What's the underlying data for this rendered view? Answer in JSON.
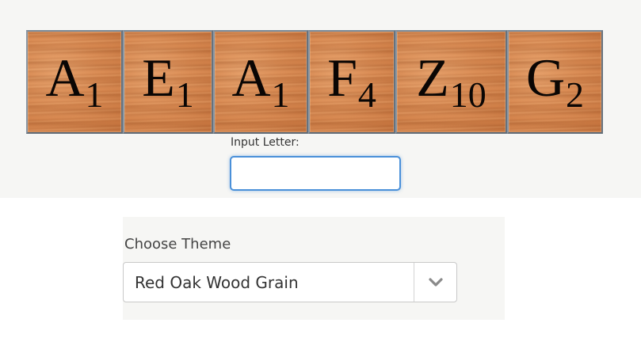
{
  "tiles": [
    {
      "letter": "A",
      "score": "1"
    },
    {
      "letter": "E",
      "score": "1"
    },
    {
      "letter": "A",
      "score": "1"
    },
    {
      "letter": "F",
      "score": "4"
    },
    {
      "letter": "Z",
      "score": "10"
    },
    {
      "letter": "G",
      "score": "2"
    }
  ],
  "input": {
    "label": "Input Letter:",
    "value": ""
  },
  "theme": {
    "label": "Choose Theme",
    "selected": "Red Oak Wood Grain",
    "chevron_icon": "chevron-down-icon"
  },
  "colors": {
    "input_focus": "#4a90d9",
    "tile_wood": "#d98a52",
    "panel_bg": "#f6f6f4"
  }
}
